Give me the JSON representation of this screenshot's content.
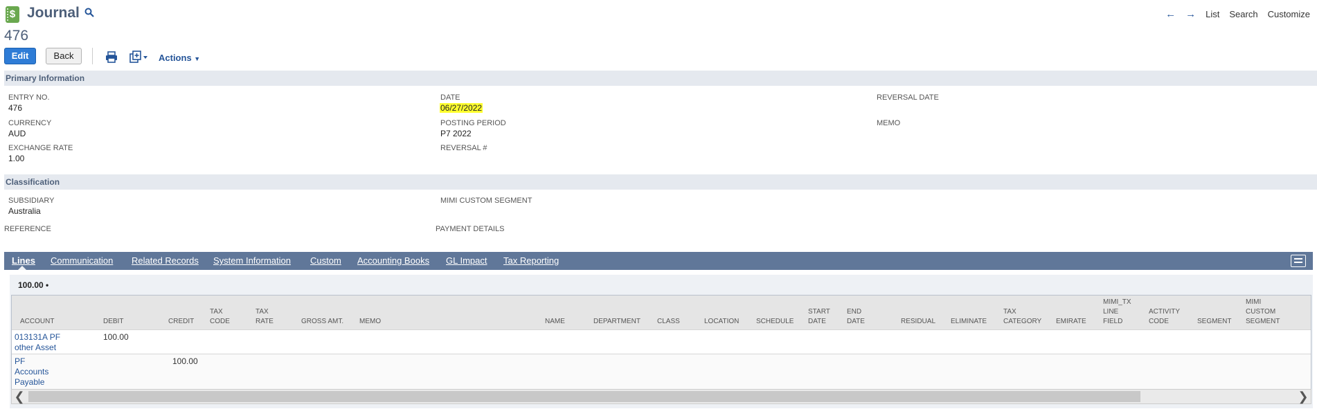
{
  "header": {
    "record_type": "Journal",
    "record_number": "476",
    "nav": {
      "list": "List",
      "search": "Search",
      "customize": "Customize"
    }
  },
  "toolbar": {
    "edit": "Edit",
    "back": "Back",
    "actions": "Actions"
  },
  "primary": {
    "title": "Primary Information",
    "entry_no_label": "ENTRY NO.",
    "entry_no": "476",
    "date_label": "DATE",
    "date": "06/27/2022",
    "reversal_date_label": "REVERSAL DATE",
    "currency_label": "CURRENCY",
    "currency": "AUD",
    "posting_period_label": "POSTING PERIOD",
    "posting_period": "P7 2022",
    "memo_label": "MEMO",
    "exchange_rate_label": "EXCHANGE RATE",
    "exchange_rate": "1.00",
    "reversal_no_label": "REVERSAL #"
  },
  "classification": {
    "title": "Classification",
    "subsidiary_label": "SUBSIDIARY",
    "subsidiary": "Australia",
    "mimi_label": "MIMI CUSTOM SEGMENT",
    "reference_label": "REFERENCE",
    "payment_details_label": "PAYMENT DETAILS"
  },
  "tabs": [
    "Lines",
    "Communication",
    "Related Records",
    "System Information",
    "Custom",
    "Accounting Books",
    "GL Impact",
    "Tax Reporting"
  ],
  "lines": {
    "subtotal": "100.00 •",
    "columns": [
      "ACCOUNT",
      "DEBIT",
      "CREDIT",
      "TAX CODE",
      "TAX RATE",
      "GROSS AMT.",
      "MEMO",
      "NAME",
      "DEPARTMENT",
      "CLASS",
      "LOCATION",
      "SCHEDULE",
      "START DATE",
      "END DATE",
      "RESIDUAL",
      "ELIMINATE",
      "TAX CATEGORY",
      "EMIRATE",
      "MIMI_TX LINE FIELD",
      "ACTIVITY CODE",
      "SEGMENT",
      "MIMI CUSTOM SEGMENT"
    ],
    "rows": [
      {
        "account": "013131A PF other Asset",
        "debit": "100.00",
        "credit": ""
      },
      {
        "account": "PF Accounts Payable",
        "debit": "",
        "credit": "100.00"
      }
    ]
  },
  "colors": {
    "tab_bar": "#607799",
    "section_header": "#e5e9ef",
    "edit_button": "#2e7cd6",
    "highlight": "#ffff2e",
    "link": "#255599"
  }
}
